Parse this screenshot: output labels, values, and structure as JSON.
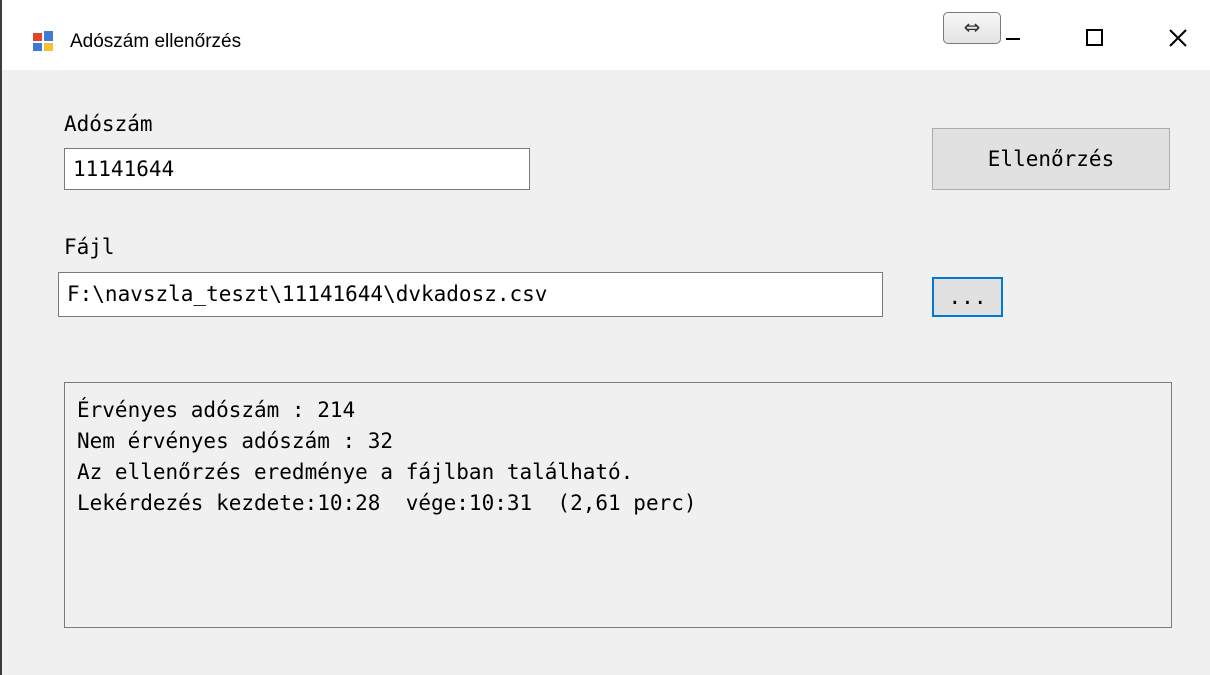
{
  "window": {
    "title": "Adószám ellenőrzés",
    "swap_glyph": "⇔",
    "app_icon": "forms-app-icon"
  },
  "form": {
    "tax_label": "Adószám",
    "tax_value": "11141644",
    "check_button": "Ellenőrzés",
    "file_label": "Fájl",
    "file_value": "F:\\navszla_teszt\\11141644\\dvkadosz.csv",
    "browse_button": "..."
  },
  "output": {
    "lines": [
      "Érvényes adószám : 214",
      "Nem érvényes adószám : 32",
      "Az ellenőrzés eredménye a fájlban található.",
      "Lekérdezés kezdete:10:28  vége:10:31  (2,61 perc)"
    ]
  },
  "colors": {
    "focus_border": "#0078d7",
    "window_bg": "#f0f0f0"
  }
}
